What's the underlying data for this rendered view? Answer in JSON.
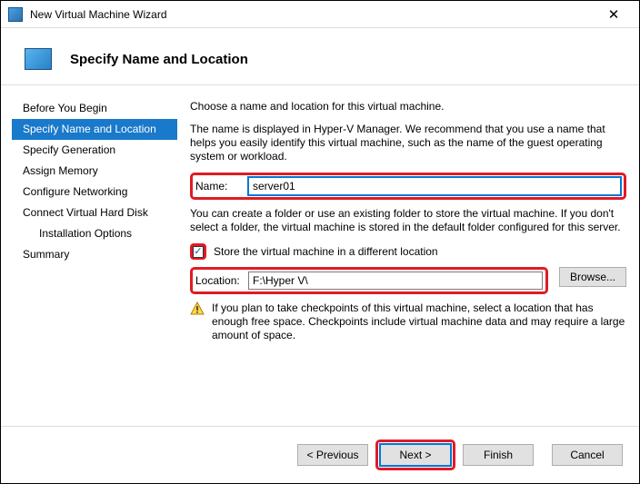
{
  "titlebar": {
    "title": "New Virtual Machine Wizard"
  },
  "header": {
    "title": "Specify Name and Location"
  },
  "sidebar": {
    "items": [
      {
        "label": "Before You Begin",
        "active": false
      },
      {
        "label": "Specify Name and Location",
        "active": true
      },
      {
        "label": "Specify Generation",
        "active": false
      },
      {
        "label": "Assign Memory",
        "active": false
      },
      {
        "label": "Configure Networking",
        "active": false
      },
      {
        "label": "Connect Virtual Hard Disk",
        "active": false
      },
      {
        "label": "Installation Options",
        "active": false,
        "sub": true
      },
      {
        "label": "Summary",
        "active": false
      }
    ]
  },
  "content": {
    "intro": "Choose a name and location for this virtual machine.",
    "name_hint": "The name is displayed in Hyper-V Manager. We recommend that you use a name that helps you easily identify this virtual machine, such as the name of the guest operating system or workload.",
    "name_label": "Name:",
    "name_value": "server01",
    "folder_hint": "You can create a folder or use an existing folder to store the virtual machine. If you don't select a folder, the virtual machine is stored in the default folder configured for this server.",
    "store_checkbox_label": "Store the virtual machine in a different location",
    "store_checked": true,
    "location_label": "Location:",
    "location_value": "F:\\Hyper V\\",
    "browse_label": "Browse...",
    "warning": "If you plan to take checkpoints of this virtual machine, select a location that has enough free space. Checkpoints include virtual machine data and may require a large amount of space."
  },
  "footer": {
    "previous": "< Previous",
    "next": "Next >",
    "finish": "Finish",
    "cancel": "Cancel"
  }
}
